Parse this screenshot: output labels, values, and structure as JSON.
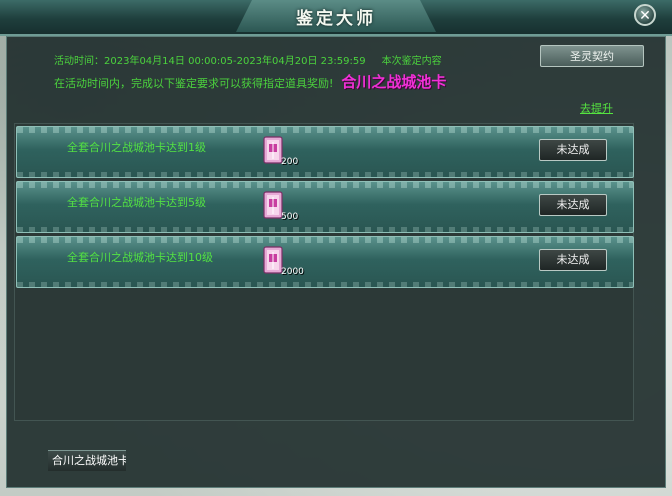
{
  "window": {
    "title": "鉴定大师",
    "close_label": "✕"
  },
  "event": {
    "time_line": "活动时间：2023年04月14日 00:00:05-2023年04月20日 23:59:59",
    "content_label": "本次鉴定内容",
    "reward_line": "在活动时间内，完成以下鉴定要求可以获得指定道具奖励!",
    "highlight": "合川之战城池卡"
  },
  "buttons": {
    "contract": "圣灵契约",
    "upgrade_link": "去提升"
  },
  "tasks": [
    {
      "description": "全套合川之战城池卡达到1级",
      "reward_icon": "card-pack-icon",
      "reward_count": "200",
      "status": "未达成"
    },
    {
      "description": "全套合川之战城池卡达到5级",
      "reward_icon": "card-pack-icon",
      "reward_count": "500",
      "status": "未达成"
    },
    {
      "description": "全套合川之战城池卡达到10级",
      "reward_icon": "card-pack-icon",
      "reward_count": "2000",
      "status": "未达成"
    }
  ],
  "bottom_tab": {
    "label": "合川之战城池卡"
  },
  "colors": {
    "accent_green": "#4bd23d",
    "highlight_magenta": "#f030d6",
    "row_teal": "#2f625e"
  }
}
